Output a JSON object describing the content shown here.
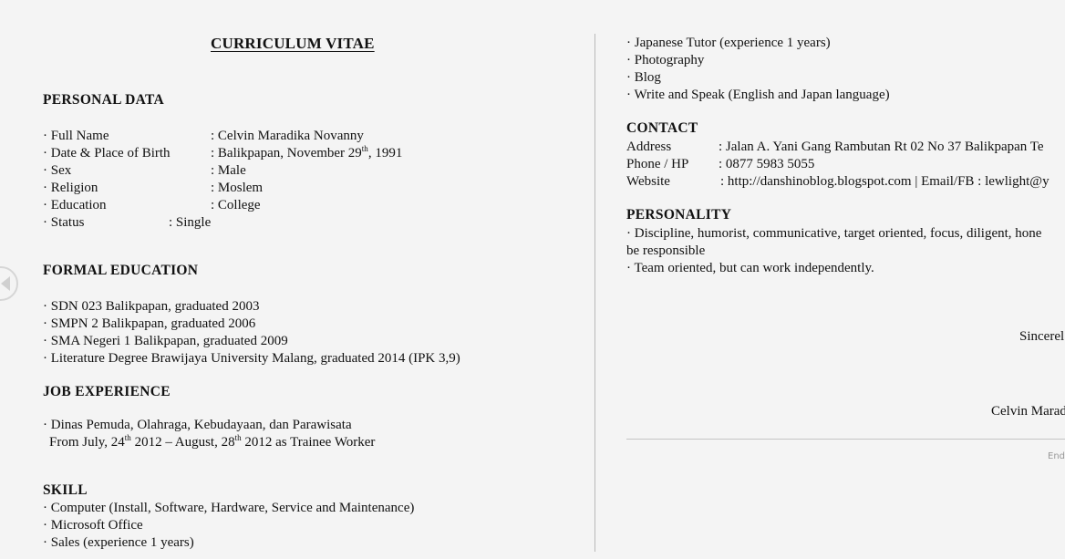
{
  "document": {
    "title": "CURRICULUM VITAE",
    "personal_data": {
      "heading": "PERSONAL DATA",
      "fields": [
        {
          "label": "· Full Name",
          "value": ": Celvin Maradika Novanny"
        },
        {
          "label": "· Date & Place of Birth",
          "value_pre": ": Balikpapan, November 29",
          "value_sup": "th",
          "value_post": ", 1991"
        },
        {
          "label": "· Sex",
          "value": ": Male"
        },
        {
          "label": "· Religion",
          "value": ": Moslem"
        },
        {
          "label": "· Education",
          "value": ": College"
        },
        {
          "label": "· Status",
          "value": ": Single"
        }
      ]
    },
    "formal_education": {
      "heading": "FORMAL EDUCATION",
      "items": [
        "· SDN 023 Balikpapan, graduated 2003",
        "· SMPN 2 Balikpapan, graduated 2006",
        "· SMA Negeri 1 Balikpapan, graduated 2009",
        "· Literature Degree Brawijaya University Malang, graduated 2014  (IPK 3,9)"
      ]
    },
    "job_experience": {
      "heading": "JOB EXPERIENCE",
      "employer": "· Dinas Pemuda, Olahraga, Kebudayaan, dan Parawisata",
      "period": {
        "p1": "From July, 24",
        "s1": "th",
        "p2": " 2012 – August, 28",
        "s2": "th",
        "p3": " 2012 as Trainee Worker"
      }
    },
    "skill": {
      "heading": "SKILL",
      "items": [
        "· Computer (Install, Software, Hardware, Service and Maintenance)",
        "· Microsoft Office",
        "· Sales (experience 1 years)",
        "· Japanese Tutor (experience 1 years)",
        "· Photography",
        "· Blog",
        "· Write and Speak (English and Japan language)"
      ]
    },
    "contact": {
      "heading": "CONTACT",
      "fields": [
        {
          "label": "Address",
          "value": ": Jalan A. Yani Gang Rambutan Rt 02 No 37 Balikpapan Te"
        },
        {
          "label": "Phone / HP",
          "value": ": 0877 5983 5055"
        },
        {
          "label": "Website",
          "value": ": http://danshinoblog.blogspot.com | Email/FB : lewlight@y"
        }
      ]
    },
    "personality": {
      "heading": "PERSONALITY",
      "lines": [
        "· Discipline, humorist, communicative, target oriented, focus, diligent, hone",
        "be responsible",
        "· Team oriented, but can work independently."
      ]
    },
    "closing": {
      "salutation": "Sincerel",
      "signature": "Celvin Marad"
    }
  },
  "viewer": {
    "prev_icon": "chevron-left-circle-icon",
    "end_label": "End"
  }
}
